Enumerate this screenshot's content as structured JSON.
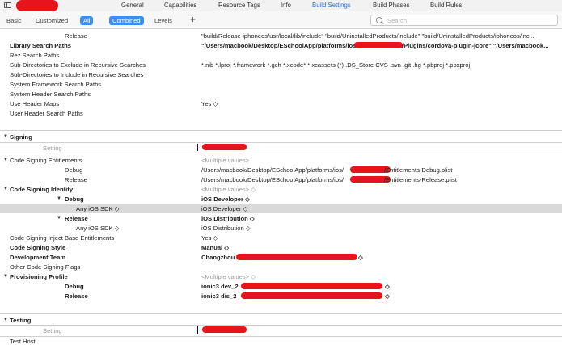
{
  "tabs": [
    "General",
    "Capabilities",
    "Resource Tags",
    "Info",
    "Build Settings",
    "Build Phases",
    "Build Rules"
  ],
  "filter": {
    "basic": "Basic",
    "customized": "Customized",
    "all": "All",
    "combined": "Combined",
    "levels": "Levels",
    "plus": "+",
    "search_placeholder": "Search"
  },
  "colors": {
    "accent": "#3b8df2",
    "active_tab": "#2a72d8",
    "redaction": "#e8141c",
    "highlight_row": "#d9d9d9"
  },
  "icons": {
    "sidebar": "sidebar-toggle-icon",
    "search": "search-icon",
    "disclosure": "disclosure-triangle-icon",
    "popup": "popup-arrows-icon"
  },
  "rows": [
    {
      "label": "Release",
      "value": "\"build/Release-iphoneos/usr/local/lib/include\" \"build/UninstalledProducts/include\" \"build/UninstalledProducts/iphoneos/incl..."
    },
    {
      "label": "Library Search Paths",
      "value": "\"/Users/macbook/Desktop/ESchoolApp/platforms/ios",
      "value2": "/Plugins/cordova-plugin-jcore\" \"/Users/macbook..."
    },
    {
      "label": "Rez Search Paths",
      "value": ""
    },
    {
      "label": "Sub-Directories to Exclude in Recursive Searches",
      "value": "*.nib *.lproj *.framework *.gch *.xcode* *.xcassets (*) .DS_Store CVS .svn .git .hg *.pbproj *.pbxproj"
    },
    {
      "label": "Sub-Directories to Include in Recursive Searches",
      "value": ""
    },
    {
      "label": "System Framework Search Paths",
      "value": ""
    },
    {
      "label": "System Header Search Paths",
      "value": ""
    },
    {
      "label": "Use Header Maps",
      "value": "Yes ◇"
    },
    {
      "label": "User Header Search Paths",
      "value": ""
    }
  ],
  "signing": {
    "title": "Signing",
    "setting": "Setting",
    "entitlements": {
      "label": "Code Signing Entitlements",
      "value": "<Multiple values>"
    },
    "ent_debug": {
      "label": "Debug",
      "value": "/Users/macbook/Desktop/ESchoolApp/platforms/ios/",
      "value2": "/Entitlements-Debug.plist"
    },
    "ent_release": {
      "label": "Release",
      "value": "/Users/macbook/Desktop/ESchoolApp/platforms/ios/",
      "value2": "/Entitlements-Release.plist"
    },
    "identity": {
      "label": "Code Signing Identity",
      "value": "<Multiple values> ◇"
    },
    "id_debug": {
      "label": "Debug",
      "value": "iOS Developer ◇"
    },
    "id_debug_sdk": {
      "label": "Any iOS SDK ◇",
      "value": "iOS Developer ◇"
    },
    "id_release": {
      "label": "Release",
      "value": "iOS Distribution ◇"
    },
    "id_release_sdk": {
      "label": "Any iOS SDK ◇",
      "value": "iOS Distribution ◇"
    },
    "inject": {
      "label": "Code Signing Inject Base Entitlements",
      "value": "Yes ◇"
    },
    "style": {
      "label": "Code Signing Style",
      "value": "Manual ◇"
    },
    "team": {
      "label": "Development Team",
      "value": "Changzhou",
      "value2": "◇"
    },
    "other_flags": {
      "label": "Other Code Signing Flags",
      "value": ""
    },
    "profile": {
      "label": "Provisioning Profile",
      "value": "<Multiple values> ◇"
    },
    "prof_debug": {
      "label": "Debug",
      "value": "ionic3 dev_2",
      "value2": "◇"
    },
    "prof_release": {
      "label": "Release",
      "value": "ionic3 dis_2",
      "value2": "◇"
    }
  },
  "testing": {
    "title": "Testing",
    "setting": "Setting",
    "test_host": "Test Host"
  }
}
